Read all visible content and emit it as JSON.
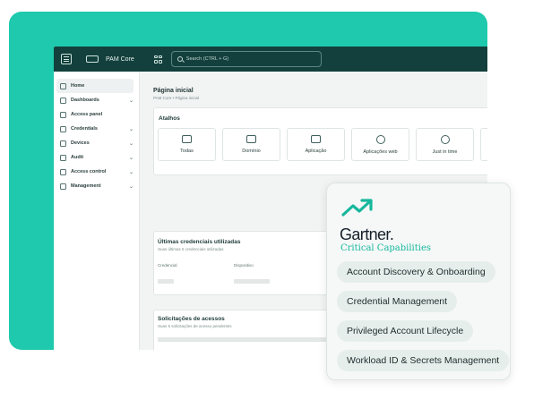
{
  "colors": {
    "brand_teal": "#1ec9ad",
    "topbar": "#13403c",
    "gartner_accent": "#17b79d"
  },
  "topbar": {
    "brand": "PAM Core",
    "search_placeholder": "Search (CTRL + G)"
  },
  "sidebar": {
    "items": [
      {
        "label": "Home",
        "icon": "home-icon",
        "expandable": false
      },
      {
        "label": "Dashboards",
        "icon": "dashboard-icon",
        "expandable": true
      },
      {
        "label": "Access panel",
        "icon": "panel-icon",
        "expandable": false
      },
      {
        "label": "Credentials",
        "icon": "key-icon",
        "expandable": true
      },
      {
        "label": "Devices",
        "icon": "monitor-icon",
        "expandable": true
      },
      {
        "label": "Audit",
        "icon": "audit-icon",
        "expandable": true
      },
      {
        "label": "Access control",
        "icon": "lock-icon",
        "expandable": true
      },
      {
        "label": "Management",
        "icon": "gear-icon",
        "expandable": true
      }
    ],
    "chevron": "⌄"
  },
  "main": {
    "title": "Página inicial",
    "breadcrumb": "PAM Core  •  Página inicial",
    "shortcuts": {
      "title": "Atalhos",
      "items": [
        {
          "label": "Todas",
          "icon": "id-card-icon"
        },
        {
          "label": "Domínio",
          "icon": "domain-icon"
        },
        {
          "label": "Aplicação",
          "icon": "apps-grid-icon"
        },
        {
          "label": "Aplicações web",
          "icon": "globe-icon"
        },
        {
          "label": "Just in time",
          "icon": "timer-icon"
        }
      ]
    },
    "recent": {
      "title": "Últimas credenciais utilizadas",
      "subtitle": "Suas últimas 5 credenciais utilizadas",
      "columns": [
        "Credencial",
        "Dispositivo"
      ]
    },
    "requests": {
      "title": "Solicitações de acessos",
      "subtitle": "Suas 5 solicitações de acesso pendentes"
    }
  },
  "gartner": {
    "logo": "Gartner.",
    "subtitle": "Critical Capabilities",
    "capabilities": [
      "Account Discovery & Onboarding",
      "Credential Management",
      "Privileged Account Lifecycle",
      "Workload ID & Secrets Management"
    ]
  }
}
